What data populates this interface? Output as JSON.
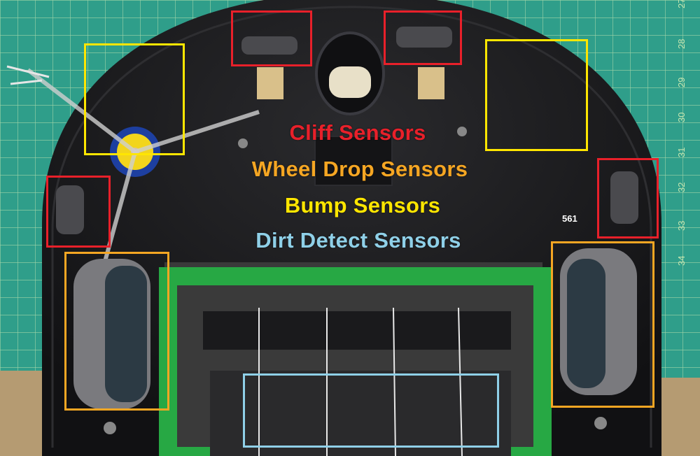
{
  "legend": {
    "cliff": "Cliff Sensors",
    "wheel_drop": "Wheel Drop Sensors",
    "bump": "Bump Sensors",
    "dirt": "Dirt Detect Sensors"
  },
  "colors": {
    "cliff": "#e8202a",
    "wheel_drop": "#f5a623",
    "bump": "#ffe600",
    "dirt": "#8fd0e8",
    "mat": "#2f9e8a",
    "robot_body": "#1c1c1e",
    "brush_frame": "#27a844"
  },
  "model_number": "561",
  "mat_numbers": [
    "27",
    "28",
    "29",
    "30",
    "31",
    "32",
    "33",
    "34"
  ]
}
